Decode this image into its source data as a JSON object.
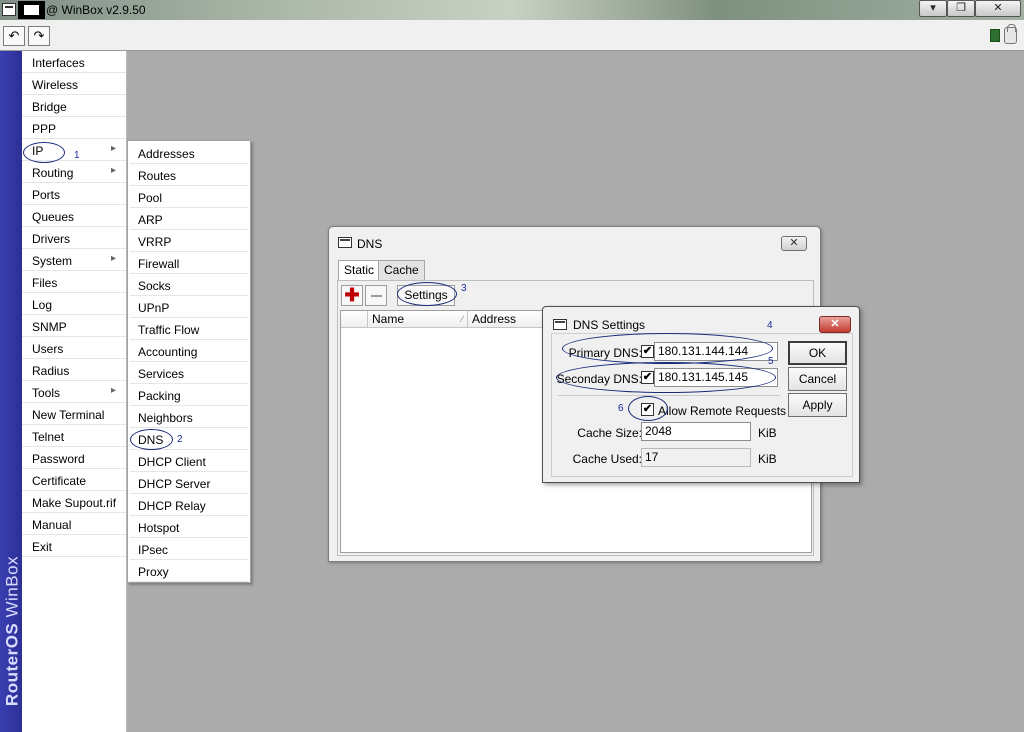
{
  "titlebar": {
    "app_title": "@ WinBox v2.9.50",
    "minimize_glyph": "▾",
    "restore_glyph": "❐",
    "close_glyph": "✕"
  },
  "toolbar": {
    "undo_glyph": "↶",
    "redo_glyph": "↷"
  },
  "brand": {
    "part1": "RouterOS",
    "part2": " WinBox"
  },
  "menu": {
    "items": [
      {
        "label": "Interfaces",
        "submenu": false
      },
      {
        "label": "Wireless",
        "submenu": false
      },
      {
        "label": "Bridge",
        "submenu": false
      },
      {
        "label": "PPP",
        "submenu": false
      },
      {
        "label": "IP",
        "submenu": true
      },
      {
        "label": "Routing",
        "submenu": true
      },
      {
        "label": "Ports",
        "submenu": false
      },
      {
        "label": "Queues",
        "submenu": false
      },
      {
        "label": "Drivers",
        "submenu": false
      },
      {
        "label": "System",
        "submenu": true
      },
      {
        "label": "Files",
        "submenu": false
      },
      {
        "label": "Log",
        "submenu": false
      },
      {
        "label": "SNMP",
        "submenu": false
      },
      {
        "label": "Users",
        "submenu": false
      },
      {
        "label": "Radius",
        "submenu": false
      },
      {
        "label": "Tools",
        "submenu": true
      },
      {
        "label": "New Terminal",
        "submenu": false
      },
      {
        "label": "Telnet",
        "submenu": false
      },
      {
        "label": "Password",
        "submenu": false
      },
      {
        "label": "Certificate",
        "submenu": false
      },
      {
        "label": "Make Supout.rif",
        "submenu": false
      },
      {
        "label": "Manual",
        "submenu": false
      },
      {
        "label": "Exit",
        "submenu": false
      }
    ]
  },
  "ip_submenu": {
    "items": [
      "Addresses",
      "Routes",
      "Pool",
      "ARP",
      "VRRP",
      "Firewall",
      "Socks",
      "UPnP",
      "Traffic Flow",
      "Accounting",
      "Services",
      "Packing",
      "Neighbors",
      "DNS",
      "DHCP Client",
      "DHCP Server",
      "DHCP Relay",
      "Hotspot",
      "IPsec",
      "Proxy"
    ]
  },
  "annotations": {
    "n1": "1",
    "n2": "2",
    "n3": "3",
    "n4": "4",
    "n5": "5",
    "n6": "6"
  },
  "dns_window": {
    "title": "DNS",
    "close_glyph": "✕",
    "tabs": [
      "Static",
      "Cache"
    ],
    "add_glyph": "✚",
    "settings_button": "Settings",
    "columns": [
      "Name",
      "Address"
    ]
  },
  "dns_settings": {
    "title": "DNS Settings",
    "close_glyph": "✕",
    "primary_label": "Primary DNS:",
    "primary_value": "180.131.144.144",
    "primary_checked": true,
    "secondary_label": "Seconday DNS:",
    "secondary_value": "180.131.145.145",
    "secondary_checked": true,
    "allow_remote_label": "Allow Remote Requests",
    "allow_remote_checked": true,
    "check_glyph": "✔",
    "cache_size_label": "Cache Size:",
    "cache_size_value": "2048",
    "cache_size_unit": "KiB",
    "cache_used_label": "Cache Used:",
    "cache_used_value": "17",
    "cache_used_unit": "KiB",
    "ok_label": "OK",
    "cancel_label": "Cancel",
    "apply_label": "Apply"
  }
}
